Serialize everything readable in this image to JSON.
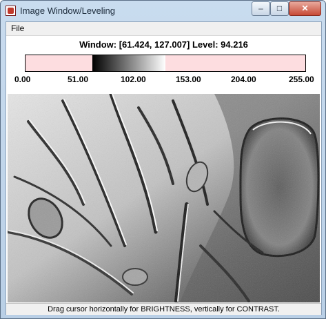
{
  "window": {
    "title": "Image Window/Leveling",
    "controls": {
      "minimize": "–",
      "maximize": "□",
      "close": "✕"
    }
  },
  "menu": {
    "file": "File"
  },
  "leveling": {
    "text": "Window: [61.424, 127.007]  Level: 94.216",
    "ticks": [
      "0.00",
      "51.00",
      "102.00",
      "153.00",
      "204.00",
      "255.00"
    ],
    "colors": {
      "out_of_range": "#fddde0",
      "ramp_start": "#000000",
      "ramp_end": "#ffffff"
    }
  },
  "status_text": "Drag cursor horizontally for BRIGHTNESS, vertically for CONTRAST.",
  "icons": [
    "app-icon",
    "minimize-icon",
    "maximize-icon",
    "close-icon"
  ]
}
